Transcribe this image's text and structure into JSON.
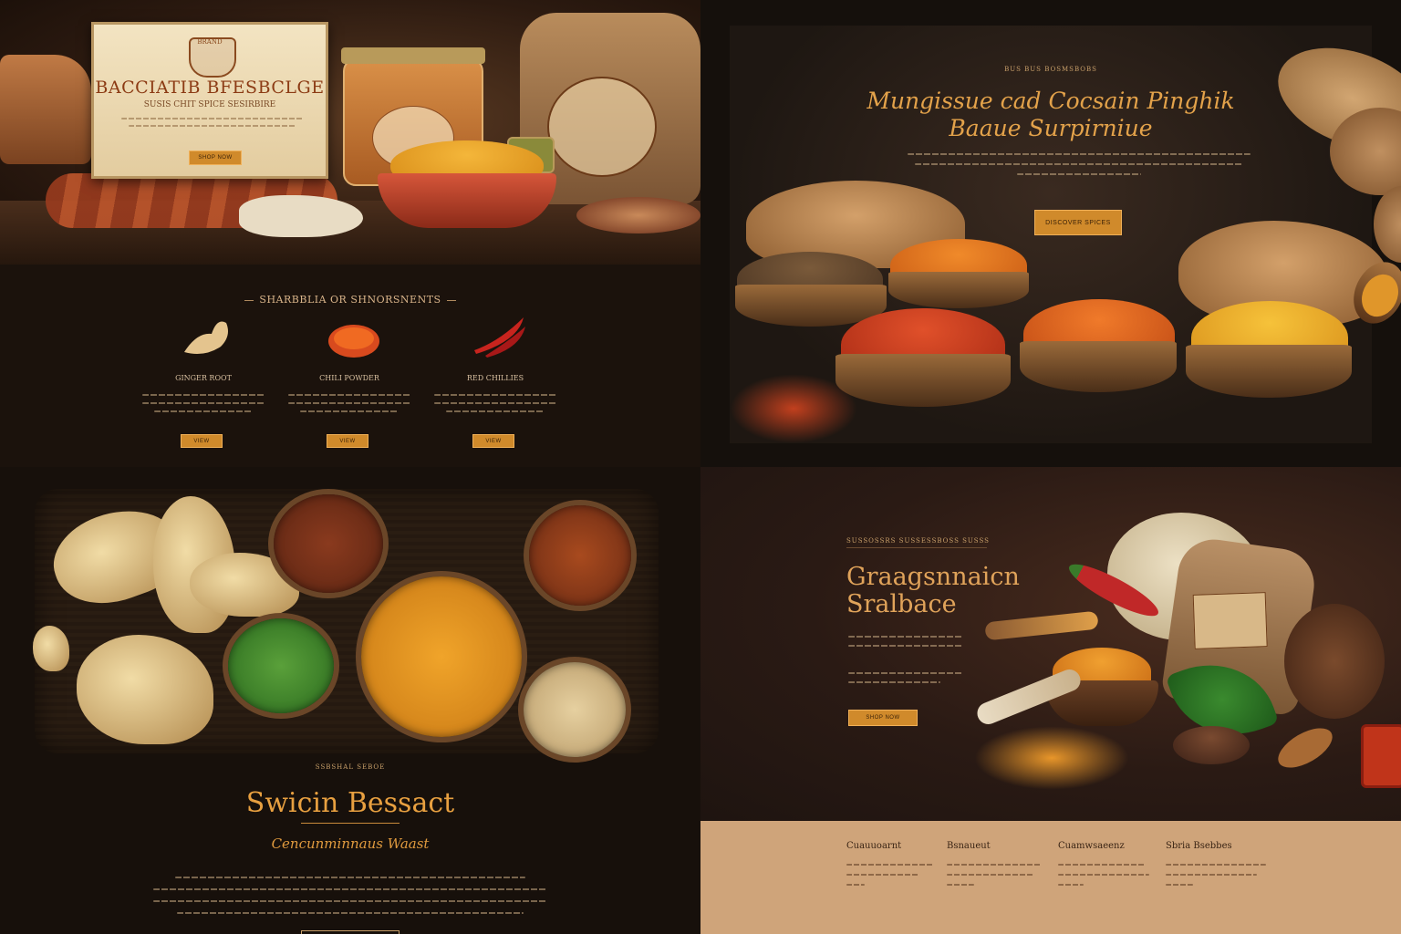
{
  "top_left": {
    "hero": {
      "crest": "BRAND",
      "title": "BACCIATIB BFESBCLGE",
      "subtitle": "SUSIS CHIT SPICE SESIRBIRE",
      "cta": "SHOP NOW"
    },
    "section_title": "SHARBBLIA OR SHNORSNENTS",
    "features": [
      {
        "name": "GINGER ROOT",
        "cta": "VIEW"
      },
      {
        "name": "CHILI POWDER",
        "cta": "VIEW"
      },
      {
        "name": "RED CHILLIES",
        "cta": "VIEW"
      }
    ]
  },
  "top_right": {
    "eyebrow": "BUS BUS BOSMSBOBS",
    "title_line1": "Mungissue cad Cocsain Pinghik",
    "title_line2": "Baaue Surpirniue",
    "cta": "DISCOVER SPICES"
  },
  "bottom_left": {
    "eyebrow": "SSBSHAL SEBOE",
    "title": "Swicin Bessact",
    "subtitle": "Cencunminnaus Waast"
  },
  "bottom_right": {
    "eyebrow": "SUSSOSSRS SUSSESSBOSS SUSSS",
    "title_line1": "Graagsnnaicn",
    "title_line2": "Sralbace",
    "cta": "SHOP NOW",
    "footer_columns": [
      {
        "heading": "Cuauuoarnt"
      },
      {
        "heading": "Bsnaueut"
      },
      {
        "heading": "Cuamwsaeenz"
      },
      {
        "heading": "Sbria Bsebbes"
      }
    ]
  },
  "colors": {
    "accent_gold": "#d08a2b",
    "title_orange": "#e3a24a",
    "dark_bg": "#1b120c",
    "footer_tan": "#cfa47a"
  }
}
